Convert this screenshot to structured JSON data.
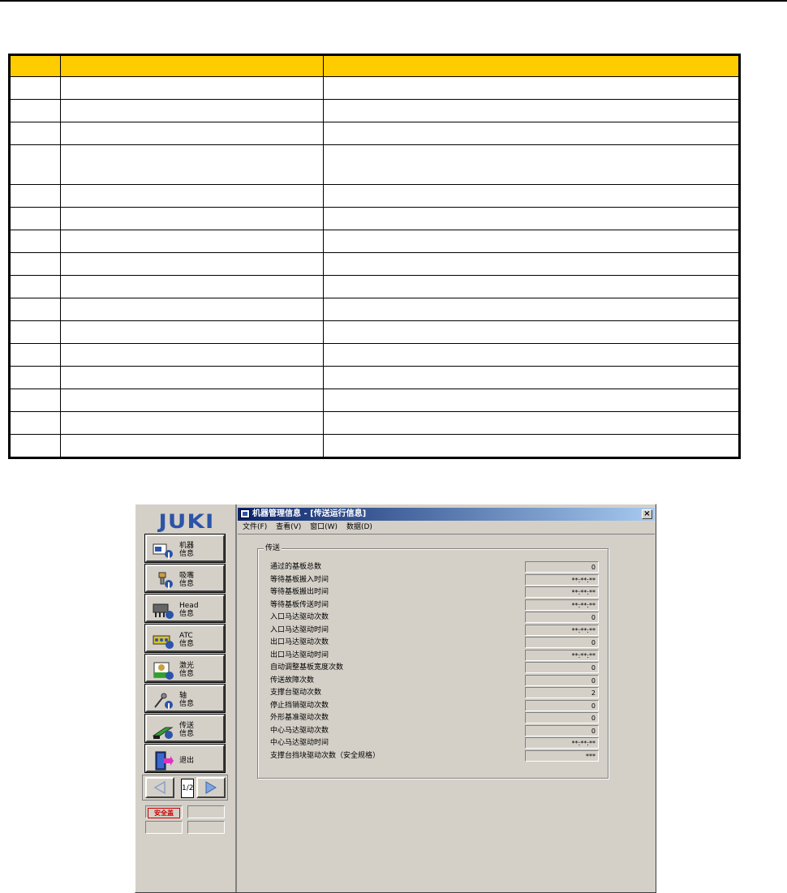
{
  "ref_table": {
    "header": [
      "",
      "",
      ""
    ],
    "rows": [
      [
        "",
        "",
        ""
      ],
      [
        "",
        "",
        ""
      ],
      [
        "",
        "",
        ""
      ],
      [
        "",
        "",
        ""
      ],
      [
        "",
        "",
        ""
      ],
      [
        "",
        "",
        ""
      ],
      [
        "",
        "",
        ""
      ],
      [
        "",
        "",
        ""
      ],
      [
        "",
        "",
        ""
      ],
      [
        "",
        "",
        ""
      ],
      [
        "",
        "",
        ""
      ],
      [
        "",
        "",
        ""
      ],
      [
        "",
        "",
        ""
      ],
      [
        "",
        "",
        ""
      ],
      [
        "",
        "",
        ""
      ],
      [
        "",
        "",
        ""
      ]
    ]
  },
  "app": {
    "logo": "JUKI",
    "nav": [
      {
        "label": "机器\n信息",
        "icon": "machine-info-icon"
      },
      {
        "label": "吸嘴\n信息",
        "icon": "nozzle-info-icon"
      },
      {
        "label": "Head\n信息",
        "icon": "head-info-icon"
      },
      {
        "label": "ATC\n信息",
        "icon": "atc-info-icon"
      },
      {
        "label": "激光\n信息",
        "icon": "laser-info-icon"
      },
      {
        "label": "轴\n信息",
        "icon": "axis-info-icon"
      },
      {
        "label": "传送\n信息",
        "icon": "conveyor-info-icon"
      },
      {
        "label": "退出",
        "icon": "exit-door-icon"
      }
    ],
    "pager": {
      "count": "1/2"
    },
    "status": {
      "safety": "安全盖"
    }
  },
  "window": {
    "title": "机器管理信息 - [传送运行信息]",
    "close": "×",
    "menu": [
      "文件(F)",
      "查看(V)",
      "窗口(W)",
      "数据(D)"
    ],
    "group_title": "传送",
    "rows": [
      {
        "label": "通过的基板总数",
        "value": "0"
      },
      {
        "label": "等待基板搬入时间",
        "value": "**:**:**"
      },
      {
        "label": "等待基板搬出时间",
        "value": "**:**:**"
      },
      {
        "label": "等待基板传送时间",
        "value": "**:**:**"
      },
      {
        "label": "入口马达驱动次数",
        "value": "0"
      },
      {
        "label": "入口马达驱动时间",
        "value": "**:**:**"
      },
      {
        "label": "出口马达驱动次数",
        "value": "0"
      },
      {
        "label": "出口马达驱动时间",
        "value": "**:**:**"
      },
      {
        "label": "自动调整基板宽度次数",
        "value": "0"
      },
      {
        "label": "传送故障次数",
        "value": "0"
      },
      {
        "label": "支撑台驱动次数",
        "value": "2"
      },
      {
        "label": "停止挡销驱动次数",
        "value": "0"
      },
      {
        "label": "外形基准驱动次数",
        "value": "0"
      },
      {
        "label": "中心马达驱动次数",
        "value": "0"
      },
      {
        "label": "中心马达驱动时间",
        "value": "**:**:**"
      },
      {
        "label": "支撑台挡块驱动次数（安全规格）",
        "value": "***"
      }
    ]
  },
  "colors": {
    "header_fill": "#ffcc00",
    "title_bar": "#0a246a",
    "logo": "#2c54a8",
    "face": "#d4d0c8"
  }
}
